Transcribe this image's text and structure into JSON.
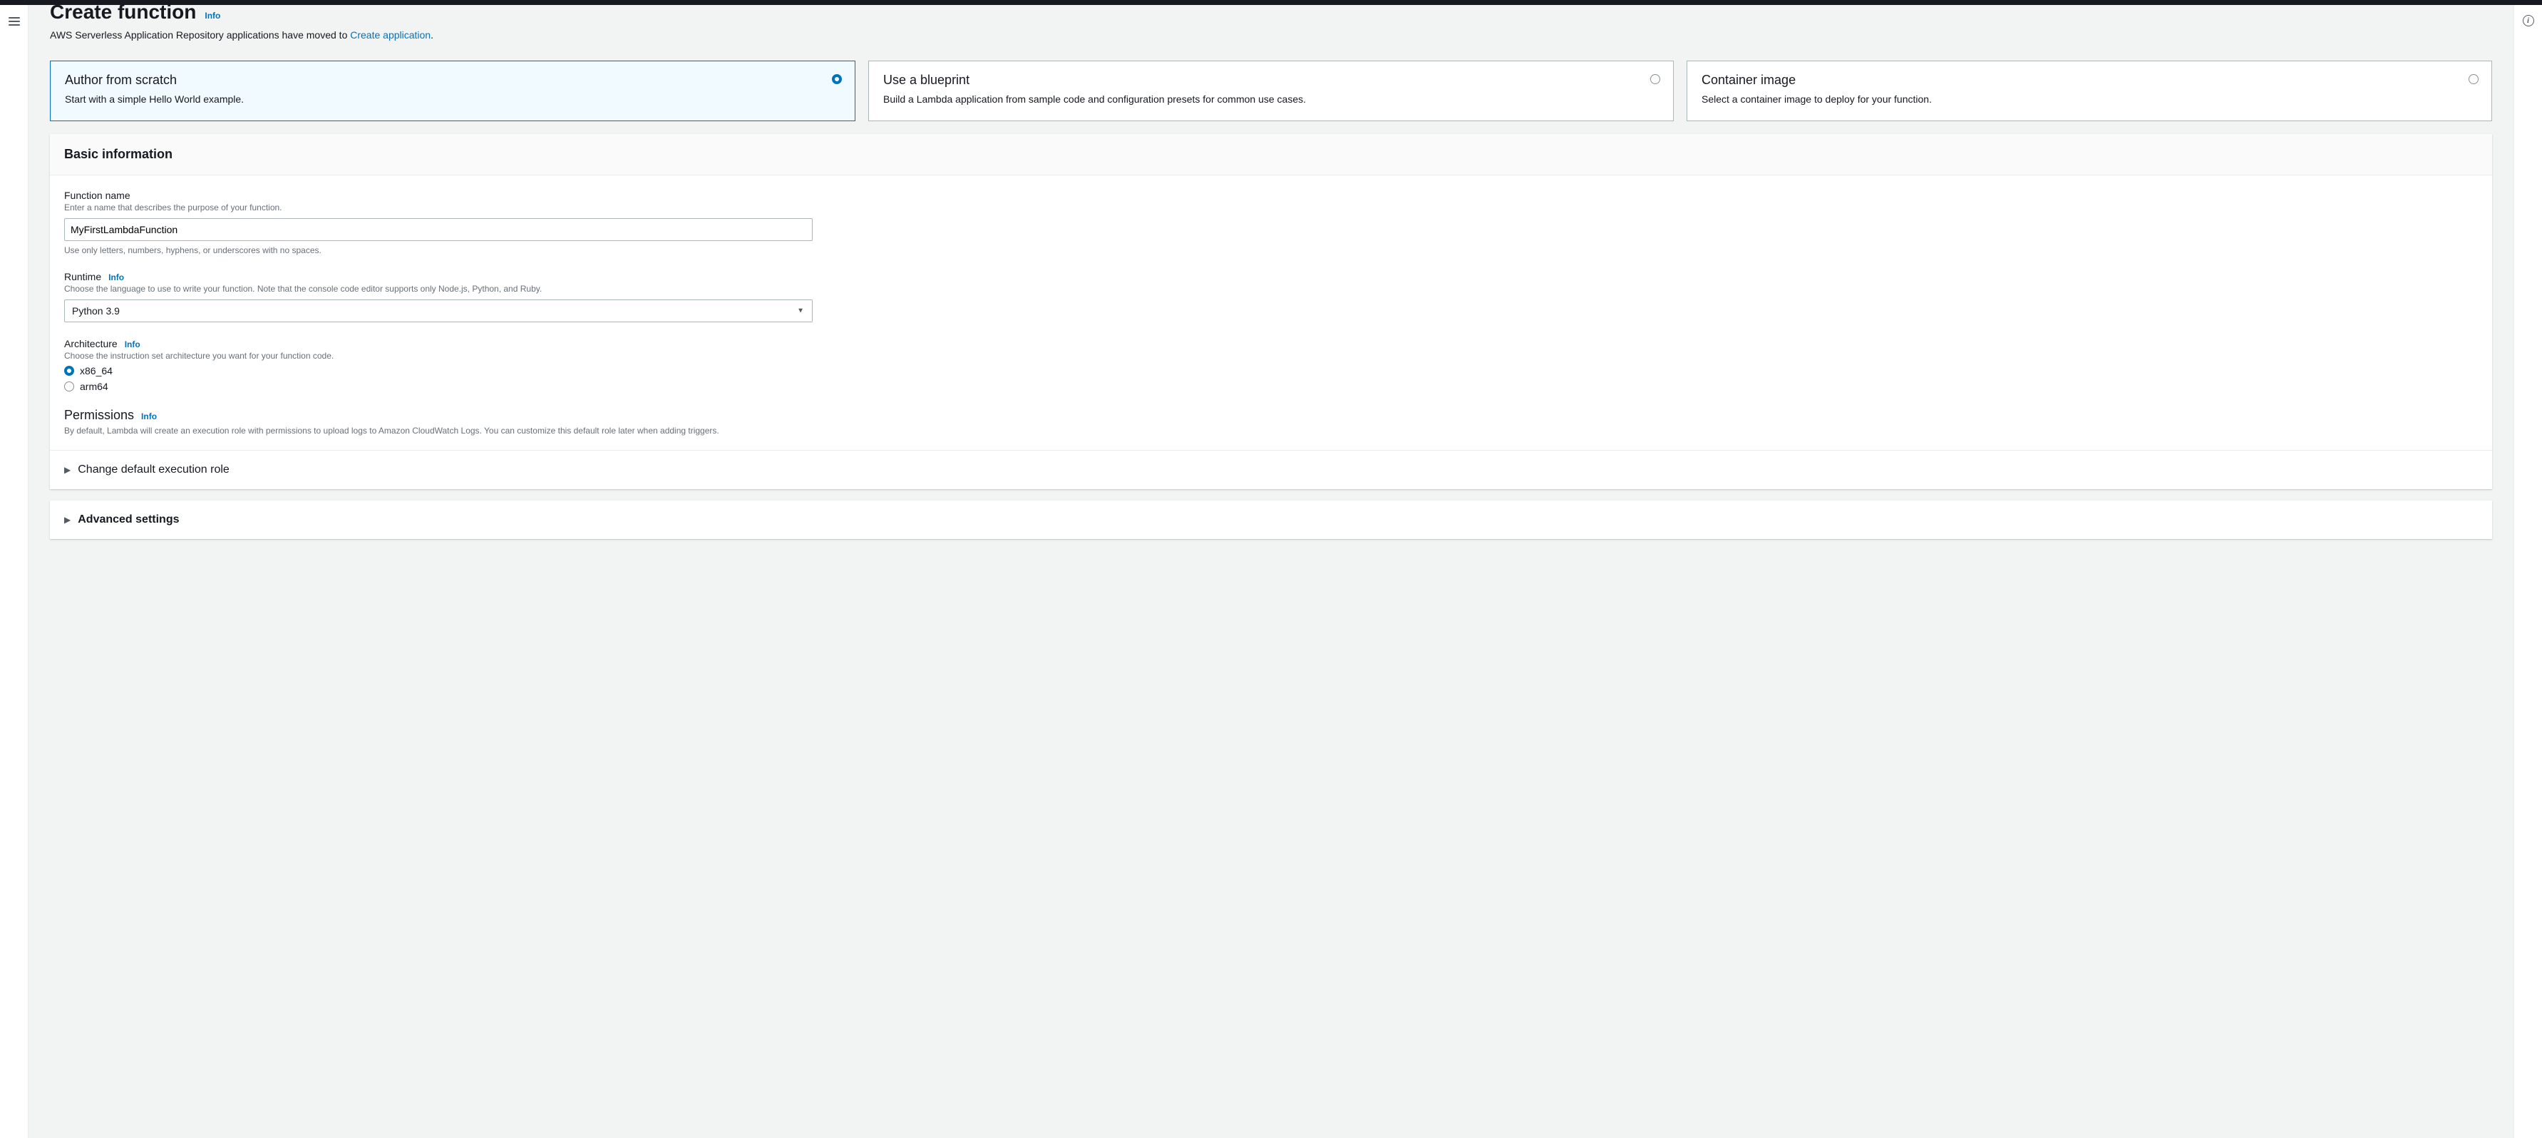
{
  "header": {
    "title": "Create function",
    "info_label": "Info",
    "repo_note_prefix": "AWS Serverless Application Repository applications have moved to ",
    "repo_note_link": "Create application",
    "repo_note_suffix": "."
  },
  "tiles": [
    {
      "title": "Author from scratch",
      "desc": "Start with a simple Hello World example.",
      "selected": true
    },
    {
      "title": "Use a blueprint",
      "desc": "Build a Lambda application from sample code and configuration presets for common use cases.",
      "selected": false
    },
    {
      "title": "Container image",
      "desc": "Select a container image to deploy for your function.",
      "selected": false
    }
  ],
  "basic": {
    "heading": "Basic information",
    "function_name": {
      "label": "Function name",
      "hint": "Enter a name that describes the purpose of your function.",
      "value": "MyFirstLambdaFunction",
      "constraint": "Use only letters, numbers, hyphens, or underscores with no spaces."
    },
    "runtime": {
      "label": "Runtime",
      "info": "Info",
      "hint": "Choose the language to use to write your function. Note that the console code editor supports only Node.js, Python, and Ruby.",
      "value": "Python 3.9"
    },
    "architecture": {
      "label": "Architecture",
      "info": "Info",
      "hint": "Choose the instruction set architecture you want for your function code.",
      "options": [
        {
          "label": "x86_64",
          "checked": true
        },
        {
          "label": "arm64",
          "checked": false
        }
      ]
    },
    "permissions": {
      "label": "Permissions",
      "info": "Info",
      "desc": "By default, Lambda will create an execution role with permissions to upload logs to Amazon CloudWatch Logs. You can customize this default role later when adding triggers."
    },
    "change_role": "Change default execution role"
  },
  "advanced": {
    "label": "Advanced settings"
  }
}
